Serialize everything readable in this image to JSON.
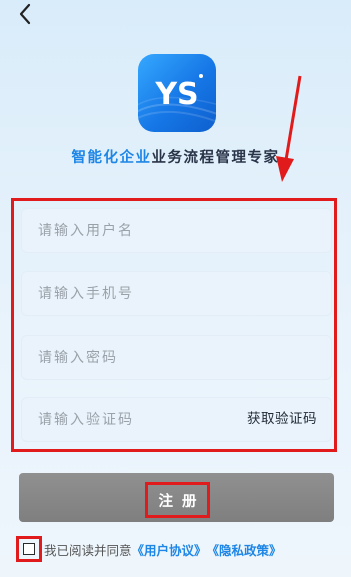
{
  "nav": {
    "back_icon": "chevron-left-icon"
  },
  "brand": {
    "logo_text": "YS",
    "slogan_highlight": "智能化企业",
    "slogan_rest": "业务流程管理专家"
  },
  "form": {
    "username_placeholder": "请输入用户名",
    "phone_placeholder": "请输入手机号",
    "password_placeholder": "请输入密码",
    "code_placeholder": "请输入验证码",
    "get_code_label": "获取验证码"
  },
  "register_label": "注册",
  "agreement": {
    "prefix": "我已阅读并同意",
    "user_agreement": "《用户协议》",
    "privacy_policy": "《隐私政策》",
    "checked": false
  },
  "colors": {
    "accent": "#1d86e6",
    "annotation_red": "#e11b1b",
    "button_gray": "#888888"
  }
}
